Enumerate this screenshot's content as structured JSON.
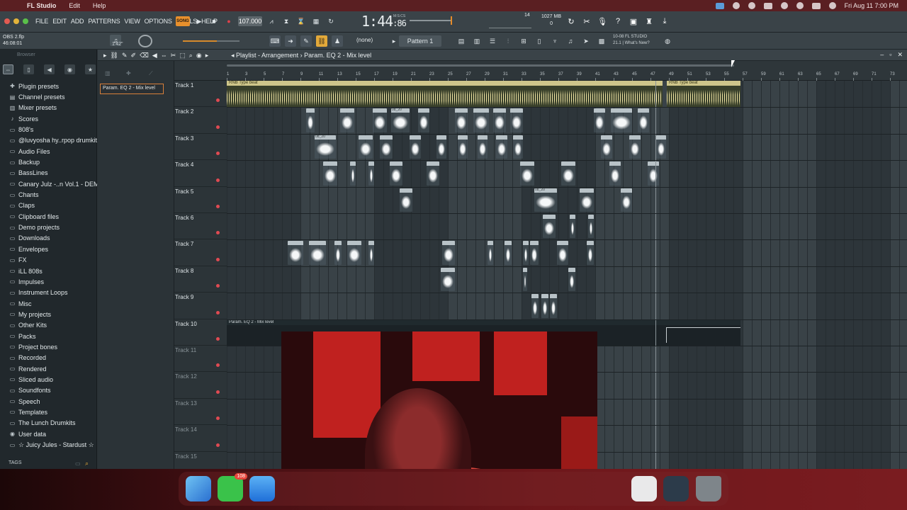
{
  "macbar": {
    "app_name": "FL Studio",
    "menus": [
      "Edit",
      "Help"
    ],
    "datetime": "Fri Aug 11  7:00 PM"
  },
  "fl": {
    "menus": [
      "FILE",
      "EDIT",
      "ADD",
      "PATTERNS",
      "VIEW",
      "OPTIONS",
      "TOOLS",
      "HELP"
    ],
    "song_label": "SONG",
    "tempo": "107.000",
    "time_main": "1:44",
    "time_sub": "86",
    "time_unit_label": "M:S:CS",
    "cpu_value": "14",
    "memory": "1027 MB",
    "memory_sub": "0",
    "hint_title": "OBS 2.flp",
    "hint_time": "46:08:01",
    "pitch_label": "1'42\"",
    "snap_label": "(none)",
    "pattern_label": "Pattern 1",
    "news_line1": "10-08  FL STUDIO",
    "news_line2": "21.1 | What's New?"
  },
  "browser": {
    "title": "Browser",
    "items": [
      {
        "label": "Plugin presets",
        "icon": "plugin-icon"
      },
      {
        "label": "Channel presets",
        "icon": "channel-icon"
      },
      {
        "label": "Mixer presets",
        "icon": "mixer-icon"
      },
      {
        "label": "Scores",
        "icon": "note-icon"
      },
      {
        "label": "808's",
        "icon": "folder-icon"
      },
      {
        "label": "@luvyosha hy..rpop drumkit",
        "icon": "folder-icon"
      },
      {
        "label": "Audio Files",
        "icon": "folder-icon"
      },
      {
        "label": "Backup",
        "icon": "folder-icon"
      },
      {
        "label": "BassLines",
        "icon": "folder-icon"
      },
      {
        "label": "Canary Julz -..n Vol.1 - DEMO",
        "icon": "folder-icon"
      },
      {
        "label": "Chants",
        "icon": "folder-icon"
      },
      {
        "label": "Claps",
        "icon": "folder-icon"
      },
      {
        "label": "Clipboard files",
        "icon": "folder-icon"
      },
      {
        "label": "Demo projects",
        "icon": "folder-icon"
      },
      {
        "label": "Downloads",
        "icon": "folder-icon"
      },
      {
        "label": "Envelopes",
        "icon": "folder-icon"
      },
      {
        "label": "FX",
        "icon": "folder-icon"
      },
      {
        "label": "iLL 808s",
        "icon": "folder-icon"
      },
      {
        "label": "Impulses",
        "icon": "folder-icon"
      },
      {
        "label": "Instrument Loops",
        "icon": "folder-icon"
      },
      {
        "label": "Misc",
        "icon": "folder-icon"
      },
      {
        "label": "My projects",
        "icon": "folder-icon"
      },
      {
        "label": "Other Kits",
        "icon": "folder-icon"
      },
      {
        "label": "Packs",
        "icon": "folder-icon"
      },
      {
        "label": "Project bones",
        "icon": "folder-icon"
      },
      {
        "label": "Recorded",
        "icon": "folder-icon"
      },
      {
        "label": "Rendered",
        "icon": "folder-icon"
      },
      {
        "label": "Sliced audio",
        "icon": "folder-icon"
      },
      {
        "label": "Soundfonts",
        "icon": "folder-icon"
      },
      {
        "label": "Speech",
        "icon": "folder-icon"
      },
      {
        "label": "Templates",
        "icon": "folder-icon"
      },
      {
        "label": "The Lunch Drumkits",
        "icon": "folder-icon"
      },
      {
        "label": "User data",
        "icon": "user-icon"
      },
      {
        "label": "☆ Juicy Jules - Stardust ☆",
        "icon": "folder-icon"
      }
    ],
    "tags_label": "TAGS"
  },
  "playlist": {
    "title": "Playlist - Arrangement",
    "breadcrumb": "Param. EQ 2 - Mix level",
    "picker_item": "Param. EQ 2 - Mix level",
    "ruler_labels": [
      "1",
      "3",
      "5",
      "7",
      "9",
      "11",
      "13",
      "15",
      "17",
      "19",
      "21",
      "23",
      "25",
      "27",
      "29",
      "31",
      "33",
      "35",
      "37",
      "39",
      "41",
      "43",
      "45",
      "47",
      "49",
      "51",
      "53",
      "55",
      "57",
      "59",
      "61",
      "63",
      "65",
      "67",
      "69",
      "71",
      "73"
    ],
    "tracks": [
      "Track 1",
      "Track 2",
      "Track 3",
      "Track 4",
      "Track 5",
      "Track 6",
      "Track 7",
      "Track 8",
      "Track 9",
      "Track 10",
      "Track 11",
      "Track 12",
      "Track 13",
      "Track 14",
      "Track 15"
    ],
    "beat_clip_label": "RNB Type beat",
    "automation_label": "Param. EQ 2 - Mix level",
    "clip_labels": [
      "08_20",
      "08_20",
      "08_20"
    ]
  },
  "dock": {
    "messages_badge": "108"
  }
}
